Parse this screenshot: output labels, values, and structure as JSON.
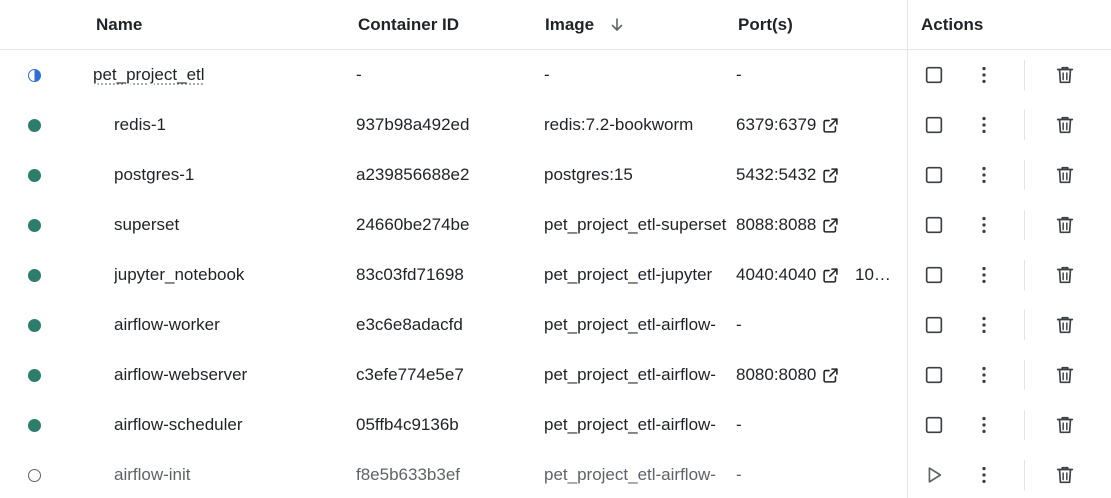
{
  "header": {
    "name": "Name",
    "container_id": "Container ID",
    "image": "Image",
    "ports": "Port(s)",
    "actions": "Actions"
  },
  "colors": {
    "running": "#2e7d6b",
    "partial": "#2f6fd6",
    "text": "#1f2226",
    "muted": "#5f6368",
    "divider": "#e3e5e8"
  },
  "rows": [
    {
      "status": "partial",
      "name": "pet_project_etl",
      "id": "-",
      "image": "-",
      "port": "-",
      "port_link": false,
      "extra": "",
      "action": "stop-square-icon"
    },
    {
      "status": "running",
      "name": "redis-1",
      "id": "937b98a492ed",
      "image": "redis:7.2-bookworm",
      "port": "6379:6379",
      "port_link": true,
      "extra": "",
      "action": "stop-square-icon"
    },
    {
      "status": "running",
      "name": "postgres-1",
      "id": "a239856688e2",
      "image": "postgres:15",
      "port": "5432:5432",
      "port_link": true,
      "extra": "",
      "action": "stop-square-icon"
    },
    {
      "status": "running",
      "name": "superset",
      "id": "24660be274be",
      "image": "pet_project_etl-superset",
      "port": "8088:8088",
      "port_link": true,
      "extra": "",
      "action": "stop-square-icon"
    },
    {
      "status": "running",
      "name": "jupyter_notebook",
      "id": "83c03fd71698",
      "image": "pet_project_etl-jupyter",
      "port": "4040:4040",
      "port_link": true,
      "extra": "10…",
      "action": "stop-square-icon"
    },
    {
      "status": "running",
      "name": "airflow-worker",
      "id": "e3c6e8adacfd",
      "image": "pet_project_etl-airflow-",
      "port": "-",
      "port_link": false,
      "extra": "",
      "action": "stop-square-icon"
    },
    {
      "status": "running",
      "name": "airflow-webserver",
      "id": "c3efe774e5e7",
      "image": "pet_project_etl-airflow-",
      "port": "8080:8080",
      "port_link": true,
      "extra": "",
      "action": "stop-square-icon"
    },
    {
      "status": "running",
      "name": "airflow-scheduler",
      "id": "05ffb4c9136b",
      "image": "pet_project_etl-airflow-",
      "port": "-",
      "port_link": false,
      "extra": "",
      "action": "stop-square-icon"
    },
    {
      "status": "stopped",
      "name": "airflow-init",
      "id": "f8e5b633b3ef",
      "image": "pet_project_etl-airflow-",
      "port": "-",
      "port_link": false,
      "extra": "",
      "action": "play-icon"
    }
  ]
}
